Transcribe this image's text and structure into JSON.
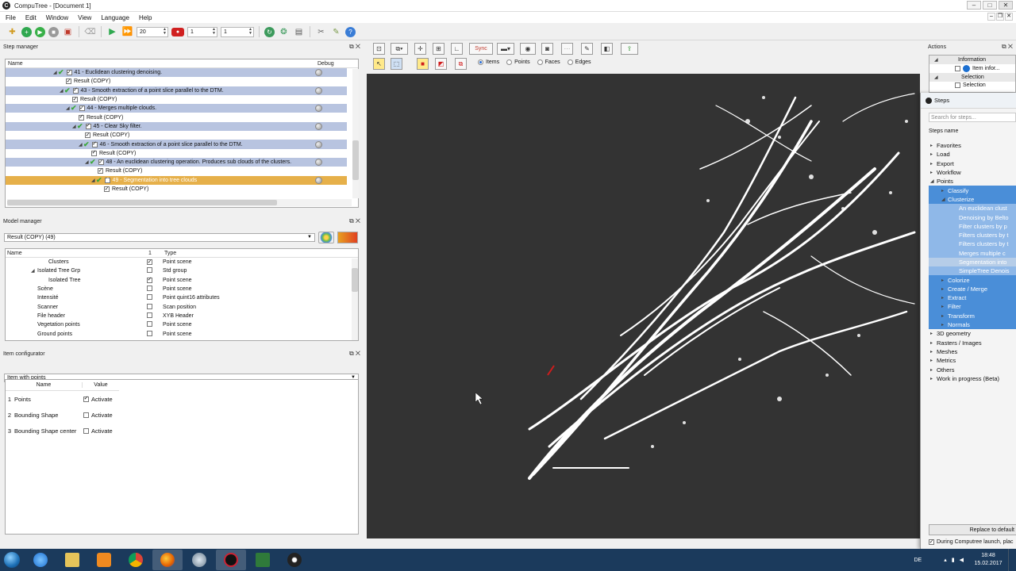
{
  "window": {
    "title": "CompuTree - [Document 1]",
    "logo": "C"
  },
  "menu": [
    "File",
    "Edit",
    "Window",
    "View",
    "Language",
    "Help"
  ],
  "toolbar": {
    "step_count": "20",
    "start_value": "1",
    "end_value": "1"
  },
  "step_manager": {
    "title": "Step manager",
    "col_name": "Name",
    "col_debug": "Debug",
    "rows": [
      {
        "label": "41 - Euclidean clustering denoising.",
        "indent": 60,
        "kind": "step"
      },
      {
        "label": "Result (COPY)",
        "indent": 76,
        "kind": "result"
      },
      {
        "label": "43 - Smooth extraction of a point slice parallel to the DTM.",
        "indent": 68,
        "kind": "step"
      },
      {
        "label": "Result (COPY)",
        "indent": 84,
        "kind": "result"
      },
      {
        "label": "44 - Merges multiple clouds.",
        "indent": 76,
        "kind": "step"
      },
      {
        "label": "Result (COPY)",
        "indent": 92,
        "kind": "result"
      },
      {
        "label": "45 - Clear Sky filter.",
        "indent": 84,
        "kind": "step"
      },
      {
        "label": "Result (COPY)",
        "indent": 100,
        "kind": "result"
      },
      {
        "label": "46 - Smooth extraction of a point slice parallel to the DTM.",
        "indent": 92,
        "kind": "step"
      },
      {
        "label": "Result (COPY)",
        "indent": 108,
        "kind": "result"
      },
      {
        "label": "48 - An euclidean clustering operation. Produces sub clouds of the clusters.",
        "indent": 100,
        "kind": "step"
      },
      {
        "label": "Result (COPY)",
        "indent": 116,
        "kind": "result"
      },
      {
        "label": "49 - Segmentation into tree clouds",
        "indent": 108,
        "kind": "active"
      },
      {
        "label": "Result (COPY)",
        "indent": 124,
        "kind": "result"
      }
    ]
  },
  "model_manager": {
    "title": "Model manager",
    "selected_result": "Result (COPY) (49)",
    "col_name": "Name",
    "col_1": "1",
    "col_type": "Type",
    "rows": [
      {
        "name": "Clusters",
        "indent": 54,
        "checked": true,
        "type": "Point scene",
        "expander": ""
      },
      {
        "name": "Isolated Tree Grp",
        "indent": 40,
        "checked": false,
        "type": "Std group",
        "expander": "◢"
      },
      {
        "name": "Isolated Tree",
        "indent": 54,
        "checked": true,
        "type": "Point scene",
        "expander": ""
      },
      {
        "name": "Scène",
        "indent": 40,
        "checked": false,
        "type": "Point scene",
        "expander": ""
      },
      {
        "name": "Intensité",
        "indent": 40,
        "checked": false,
        "type": "Point quint16 attributes",
        "expander": ""
      },
      {
        "name": "Scanner",
        "indent": 40,
        "checked": false,
        "type": "Scan position",
        "expander": ""
      },
      {
        "name": "File header",
        "indent": 40,
        "checked": false,
        "type": "XYB Header",
        "expander": ""
      },
      {
        "name": "Vegetation points",
        "indent": 40,
        "checked": false,
        "type": "Point scene",
        "expander": ""
      },
      {
        "name": "Ground points",
        "indent": 40,
        "checked": false,
        "type": "Point scene",
        "expander": ""
      }
    ]
  },
  "item_configurator": {
    "title": "Item configurator",
    "selected": "Item with points",
    "col_name": "Name",
    "col_value": "Value",
    "rows": [
      {
        "num": "1",
        "name": "Points",
        "checked": true,
        "value": "Activate"
      },
      {
        "num": "2",
        "name": "Bounding Shape",
        "checked": false,
        "value": "Activate"
      },
      {
        "num": "3",
        "name": "Bounding Shape center",
        "checked": false,
        "value": "Activate"
      }
    ]
  },
  "viewer": {
    "sync_label": "Sync",
    "select_modes": [
      {
        "label": "Items",
        "selected": true
      },
      {
        "label": "Points",
        "selected": false
      },
      {
        "label": "Faces",
        "selected": false
      },
      {
        "label": "Edges",
        "selected": false
      }
    ]
  },
  "actions": {
    "title": "Actions",
    "information": "Information",
    "item_info": "Item infor...",
    "selection": "Selection",
    "selection_item": "Selection"
  },
  "steps_panel": {
    "title": "Steps",
    "search_placeholder": "Search for steps...",
    "list_header": "Steps name",
    "items": [
      {
        "label": "Favorites",
        "indent": 0,
        "style": "",
        "arrow": "▸"
      },
      {
        "label": "Load",
        "indent": 0,
        "style": "",
        "arrow": "▸"
      },
      {
        "label": "Export",
        "indent": 0,
        "style": "",
        "arrow": "▸"
      },
      {
        "label": "Workflow",
        "indent": 0,
        "style": "",
        "arrow": "▸"
      },
      {
        "label": "Points",
        "indent": 0,
        "style": "",
        "arrow": "◢"
      },
      {
        "label": "Classify",
        "indent": 14,
        "style": "sel",
        "arrow": "▸"
      },
      {
        "label": "Clusterize",
        "indent": 14,
        "style": "sel",
        "arrow": "◢"
      },
      {
        "label": "An euclidean clust",
        "indent": 28,
        "style": "selsub",
        "arrow": ""
      },
      {
        "label": "Denoising by Belto",
        "indent": 28,
        "style": "selsub",
        "arrow": ""
      },
      {
        "label": "Filter clusters by p",
        "indent": 28,
        "style": "selsub",
        "arrow": ""
      },
      {
        "label": "Filters clusters by t",
        "indent": 28,
        "style": "selsub",
        "arrow": ""
      },
      {
        "label": "Filters clusters by t",
        "indent": 28,
        "style": "selsub",
        "arrow": ""
      },
      {
        "label": "Merges multiple c",
        "indent": 28,
        "style": "selsub",
        "arrow": ""
      },
      {
        "label": "Segmentation into",
        "indent": 28,
        "style": "hl",
        "arrow": ""
      },
      {
        "label": "SimpleTree Denois",
        "indent": 28,
        "style": "selsub",
        "arrow": ""
      },
      {
        "label": "Colorize",
        "indent": 14,
        "style": "sel",
        "arrow": "▸"
      },
      {
        "label": "Create / Merge",
        "indent": 14,
        "style": "sel",
        "arrow": "▸"
      },
      {
        "label": "Extract",
        "indent": 14,
        "style": "sel",
        "arrow": "▸"
      },
      {
        "label": "Filter",
        "indent": 14,
        "style": "sel",
        "arrow": "▸"
      },
      {
        "label": "Transform",
        "indent": 14,
        "style": "sel",
        "arrow": "▸"
      },
      {
        "label": "Normals",
        "indent": 14,
        "style": "sel",
        "arrow": "▸"
      },
      {
        "label": "3D geometry",
        "indent": 0,
        "style": "",
        "arrow": "▸"
      },
      {
        "label": "Rasters / Images",
        "indent": 0,
        "style": "",
        "arrow": "▸"
      },
      {
        "label": "Meshes",
        "indent": 0,
        "style": "",
        "arrow": "▸"
      },
      {
        "label": "Metrics",
        "indent": 0,
        "style": "",
        "arrow": "▸"
      },
      {
        "label": "Others",
        "indent": 0,
        "style": "",
        "arrow": "▸"
      },
      {
        "label": "Work in progress (Beta)",
        "indent": 0,
        "style": "",
        "arrow": "▸"
      }
    ],
    "replace_button": "Replace to default",
    "launch_checkbox": "During Computree launch, plac"
  },
  "taskbar": {
    "language": "DE",
    "time": "18:48",
    "date": "15.02.2017"
  },
  "colors": {
    "accent": "#4a8ed8",
    "step_row": "#b8c4e0",
    "active_step": "#e6b04a",
    "viewer_bg": "#333333"
  }
}
